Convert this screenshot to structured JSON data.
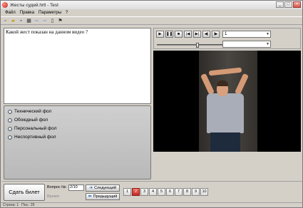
{
  "window": {
    "title": "Жесты судей.hrtl - Test",
    "min": "_",
    "max": "□",
    "close": "×"
  },
  "menu": [
    "Файл",
    "Правка",
    "Параметры",
    "?"
  ],
  "question": {
    "text": "Какой жест показан на данном видео ?"
  },
  "answers": [
    "Технический фол",
    "Обоюдный фол",
    "Персональный фол",
    "Неспортивный фол"
  ],
  "player": {
    "buttons": [
      "▶",
      "❚❚",
      "■",
      "|◀",
      "▶|",
      "◀|",
      "|▶"
    ],
    "combo1_value": "1",
    "combo2_value": "",
    "seek_position": 0.6
  },
  "bottom": {
    "make_ticket": "Сдать билет",
    "question_label": "Вопрос №:",
    "question_value": "2/10",
    "time_label": "Время:",
    "next_label": "Следующий",
    "prev_label": "Предыдущий",
    "numbers": [
      "1",
      "2",
      "3",
      "4",
      "5",
      "6",
      "7",
      "8",
      "9",
      "10"
    ],
    "active_number": "2"
  },
  "status": {
    "row": "Строка: 1",
    "pos": "Поз.: 29"
  },
  "colors": {
    "accent": "#c62828",
    "panel": "#d4d0c8"
  }
}
